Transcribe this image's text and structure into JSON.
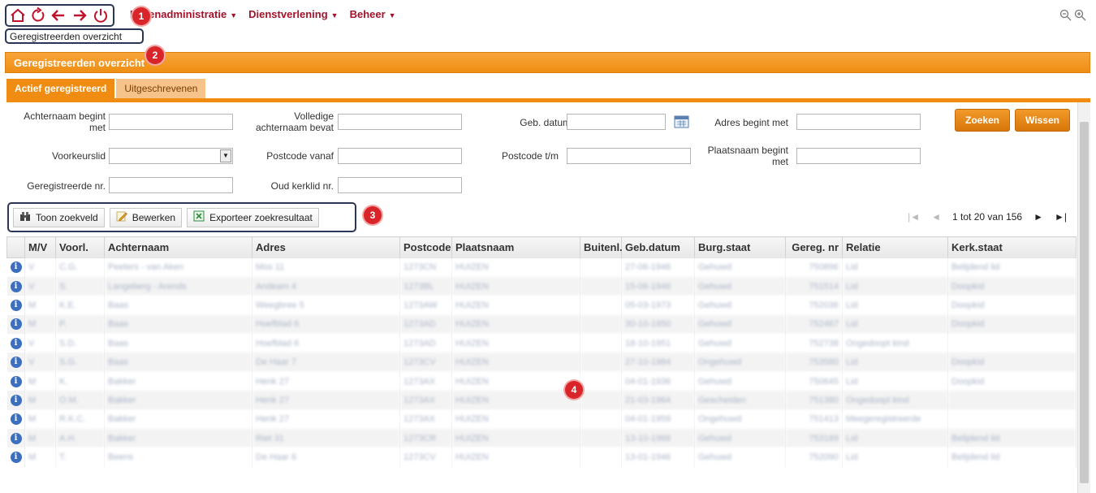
{
  "icons": {
    "home": "home-icon",
    "refresh": "refresh-icon",
    "back": "arrow-left-icon",
    "forward": "arrow-right-icon",
    "power": "power-icon",
    "zoom_out": "zoom-out-icon",
    "zoom_in": "zoom-in-icon"
  },
  "colors": {
    "accent": "#f08c12",
    "menu": "#a3122a",
    "callout": "#d9252a",
    "frame": "#2b3556"
  },
  "menu": [
    {
      "label": "Ledenadministratie"
    },
    {
      "label": "Dienstverlening"
    },
    {
      "label": "Beheer"
    }
  ],
  "breadcrumb": "Geregistreerden overzicht",
  "page_title": "Geregistreerden overzicht",
  "callouts": [
    "1",
    "2",
    "3",
    "4"
  ],
  "tabs": [
    {
      "label": "Actief geregistreerd",
      "active": true
    },
    {
      "label": "Uitgeschrevenen",
      "active": false
    }
  ],
  "search": {
    "achternaam_begint_met": "Achternaam begint met",
    "volledige_achternaam": "Volledige achternaam bevat",
    "geb_datum": "Geb. datum",
    "adres_begint_met": "Adres begint met",
    "voorkeurslid": "Voorkeurslid",
    "postcode_vanaf": "Postcode vanaf",
    "postcode_tm": "Postcode t/m",
    "plaatsnaam_begint_met": "Plaatsnaam begint met",
    "geregistreerde_nr": "Geregistreerde nr.",
    "oud_kerklid_nr": "Oud kerklid nr.",
    "zoeken": "Zoeken",
    "wissen": "Wissen"
  },
  "toolbar": {
    "toon_zoekveld": "Toon zoekveld",
    "bewerken": "Bewerken",
    "exporteer": "Exporteer zoekresultaat"
  },
  "pager": {
    "text": "1 tot 20 van 156",
    "first": "|◄",
    "prev": "◄",
    "next": "►",
    "last": "►|"
  },
  "table": {
    "columns": [
      "",
      "M/V",
      "Voorl.",
      "Achternaam",
      "Adres",
      "Postcode",
      "Plaatsnaam",
      "Buitenl.",
      "Geb.datum",
      "Burg.staat",
      "Gereg. nr",
      "Relatie",
      "Kerk.staat"
    ],
    "rows": [
      [
        "V",
        "C.G.",
        "Peeters - van Aken",
        "Mos 11",
        "1273CN",
        "HUIZEN",
        "",
        "27-06-1946",
        "Gehuwd",
        "750896",
        "Lid",
        "Belijdend lid"
      ],
      [
        "V",
        "S.",
        "Langeberg - Arends",
        "Andeam 4",
        "1273BL",
        "HUIZEN",
        "",
        "15-06-1946",
        "Gehuwd",
        "751514",
        "Lid",
        "Doopkid"
      ],
      [
        "M",
        "K.E.",
        "Baas",
        "Weegbree 5",
        "1273AW",
        "HUIZEN",
        "",
        "05-03-1973",
        "Gehuwd",
        "752036",
        "Lid",
        "Doopkid"
      ],
      [
        "M",
        "P.",
        "Baas",
        "Hoefblad 6",
        "1273AD",
        "HUIZEN",
        "",
        "30-10-1950",
        "Gehuwd",
        "752467",
        "Lid",
        "Doopkid"
      ],
      [
        "V",
        "S.D.",
        "Baas",
        "Hoefblad 6",
        "1273AD",
        "HUIZEN",
        "",
        "18-10-1951",
        "Gehuwd",
        "752738",
        "Ongedoopt kind",
        ""
      ],
      [
        "V",
        "S.G.",
        "Baas",
        "De Haar 7",
        "1273CV",
        "HUIZEN",
        "",
        "27-10-1984",
        "Ongehuwd",
        "753580",
        "Lid",
        "Doopkid"
      ],
      [
        "M",
        "K.",
        "Bakker",
        "Henk 27",
        "1273AX",
        "HUIZEN",
        "",
        "04-01-1936",
        "Gehuwd",
        "750645",
        "Lid",
        "Doopkid"
      ],
      [
        "M",
        "O.M.",
        "Bakker",
        "Henk 27",
        "1273AX",
        "HUIZEN",
        "",
        "21-03-1964",
        "Gescheiden",
        "751380",
        "Ongedoopt kind",
        ""
      ],
      [
        "M",
        "R.K.C.",
        "Bakker",
        "Henk 27",
        "1273AX",
        "HUIZEN",
        "",
        "04-01-1959",
        "Ongehuwd",
        "751413",
        "Meegeregistreerde",
        ""
      ],
      [
        "M",
        "A.H.",
        "Bakker",
        "Riet 31",
        "1273CR",
        "HUIZEN",
        "",
        "13-10-1966",
        "Gehuwd",
        "753189",
        "Lid",
        "Belijdend lid"
      ],
      [
        "M",
        "T.",
        "Beens",
        "De Haar 6",
        "1273CV",
        "HUIZEN",
        "",
        "13-01-1946",
        "Gehuwd",
        "752090",
        "Lid",
        "Belijdend lid"
      ]
    ]
  }
}
